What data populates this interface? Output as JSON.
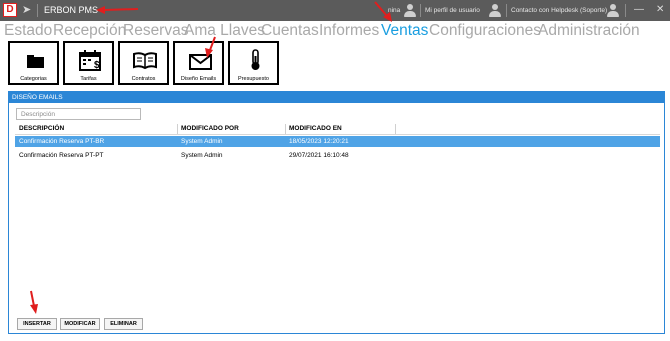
{
  "titlebar": {
    "app_name": "ERBON PMS",
    "partial_label": "nina",
    "profile_link": "Mi perfil de usuario",
    "helpdesk_link": "Contacto con Helpdesk (Soporte)",
    "logo_glyph": "D"
  },
  "menu": {
    "items": [
      {
        "label": "Estado"
      },
      {
        "label": "Recepción"
      },
      {
        "label": "Reservas"
      },
      {
        "label": "Ama Llaves"
      },
      {
        "label": "Cuentas"
      },
      {
        "label": "Informes"
      },
      {
        "label": "Ventas"
      },
      {
        "label": "Configuraciones"
      },
      {
        "label": "Administración"
      }
    ],
    "active": "Ventas",
    "active_color": "#1a9ee0",
    "inactive_color": "#a9a9a9"
  },
  "tiles": [
    {
      "label": "Categorias",
      "icon": "folder-icon"
    },
    {
      "label": "Tarifas",
      "icon": "calendar-dollar-icon"
    },
    {
      "label": "Contratos",
      "icon": "book-icon"
    },
    {
      "label": "Diseño Emails",
      "icon": "envelope-icon"
    },
    {
      "label": "Presupuesto",
      "icon": "thermometer-icon"
    }
  ],
  "panel": {
    "title": "DISEÑO EMAILS",
    "search_placeholder": "Descripción",
    "columns": [
      "DESCRIPCIÓN",
      "MODIFICADO POR",
      "MODIFICADO EN"
    ],
    "rows": [
      {
        "description": "Confirmación Reserva PT-BR",
        "modified_by": "System Admin",
        "modified_at": "18/05/2023 12:20:21",
        "selected": true
      },
      {
        "description": "Confirmación Reserva PT-PT",
        "modified_by": "System Admin",
        "modified_at": "29/07/2021 16:10:48",
        "selected": false
      }
    ],
    "buttons": {
      "insert": "INSERTAR",
      "modify": "MODIFICAR",
      "delete": "ELIMINAR"
    },
    "accent_color": "#2b86d6",
    "selected_row_color": "#4fa3e6"
  }
}
